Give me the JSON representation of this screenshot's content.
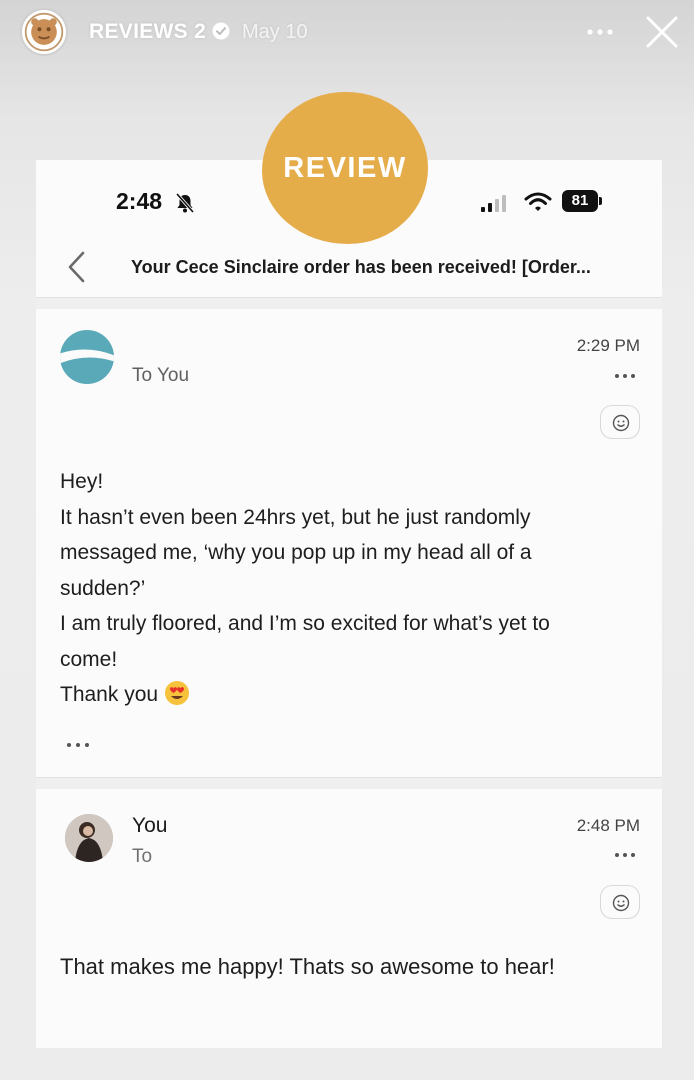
{
  "story": {
    "account_name": "REVIEWS 2",
    "date": "May 10",
    "sticker_text": "REVIEW",
    "sticker_color": "#e5ac4a"
  },
  "status_bar": {
    "time": "2:48",
    "battery": "81"
  },
  "email": {
    "subject": "Your Cece Sinclaire order has been received! [Order...",
    "messages": [
      {
        "to": "To You",
        "time": "2:29 PM",
        "body": [
          "Hey!",
          "It hasn’t even been 24hrs yet, but he just randomly",
          "messaged me, ‘why you pop up in my head all of a",
          "sudden?’",
          "I am truly floored, and I’m so excited for what’s yet to",
          "come!",
          "Thank you"
        ]
      },
      {
        "sender": "You",
        "to": "To",
        "time": "2:48 PM",
        "body": "That makes me happy! Thats so awesome to hear!"
      }
    ]
  },
  "icons": [
    "story-avatar-icon",
    "verified-icon",
    "more-icon",
    "close-icon",
    "bell-slash-icon",
    "signal-icon",
    "wifi-icon",
    "battery-icon",
    "back-chevron-icon",
    "sender-logo-icon",
    "smiley-react-icon",
    "heart-eyes-emoji-icon",
    "ellipsis-icon"
  ]
}
